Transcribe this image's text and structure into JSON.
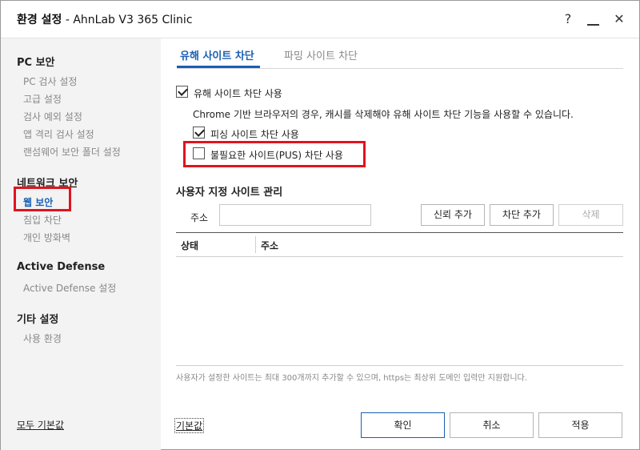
{
  "window": {
    "title_bold": "환경 설정",
    "title_rest": " - AhnLab V3 365 Clinic",
    "help_icon": "?",
    "minimize_icon": "minimize-icon",
    "close_icon": "✕"
  },
  "sidebar": {
    "sections": [
      {
        "title": "PC 보안",
        "items": [
          "PC 검사 설정",
          "고급 설정",
          "검사 예외 설정",
          "앱 격리 검사 설정",
          "랜섬웨어 보안 폴더 설정"
        ]
      },
      {
        "title": "네트워크 보안",
        "items": [
          "웹 보안",
          "침입 차단",
          "개인 방화벽"
        ]
      },
      {
        "title": "Active Defense",
        "items": [
          "Active Defense 설정"
        ]
      },
      {
        "title": "기타 설정",
        "items": [
          "사용 환경"
        ]
      }
    ],
    "active_item": "웹 보안",
    "reset_all": "모두 기본값"
  },
  "tabs": [
    {
      "label": "유해 사이트 차단",
      "active": true
    },
    {
      "label": "파밍 사이트 차단",
      "active": false
    }
  ],
  "options": {
    "block_harmful": {
      "label": "유해 사이트 차단 사용",
      "checked": true
    },
    "description": "Chrome 기반 브라우저의 경우, 캐시를 삭제해야 유해 사이트 차단 기능을 사용할 수 있습니다.",
    "block_phishing": {
      "label": "피싱 사이트 차단 사용",
      "checked": true
    },
    "block_pus": {
      "label": "불필요한 사이트(PUS) 차단 사용",
      "checked": false
    }
  },
  "custom_sites": {
    "title": "사용자 지정 사이트 관리",
    "address_label": "주소",
    "address_value": "",
    "trust_button": "신뢰 추가",
    "block_button": "차단 추가",
    "delete_button": "삭제",
    "columns": [
      "상태",
      "주소"
    ],
    "rows": []
  },
  "note": "사용자가 설정한 사이트는 최대 300개까지 추가할 수 있으며, https는 최상위 도메인 입력만 지원합니다.",
  "footer": {
    "reset_link": "기본값",
    "ok": "확인",
    "cancel": "취소",
    "apply": "적용"
  },
  "colors": {
    "accent": "#1a5fb4",
    "highlight": "#e0141e"
  }
}
